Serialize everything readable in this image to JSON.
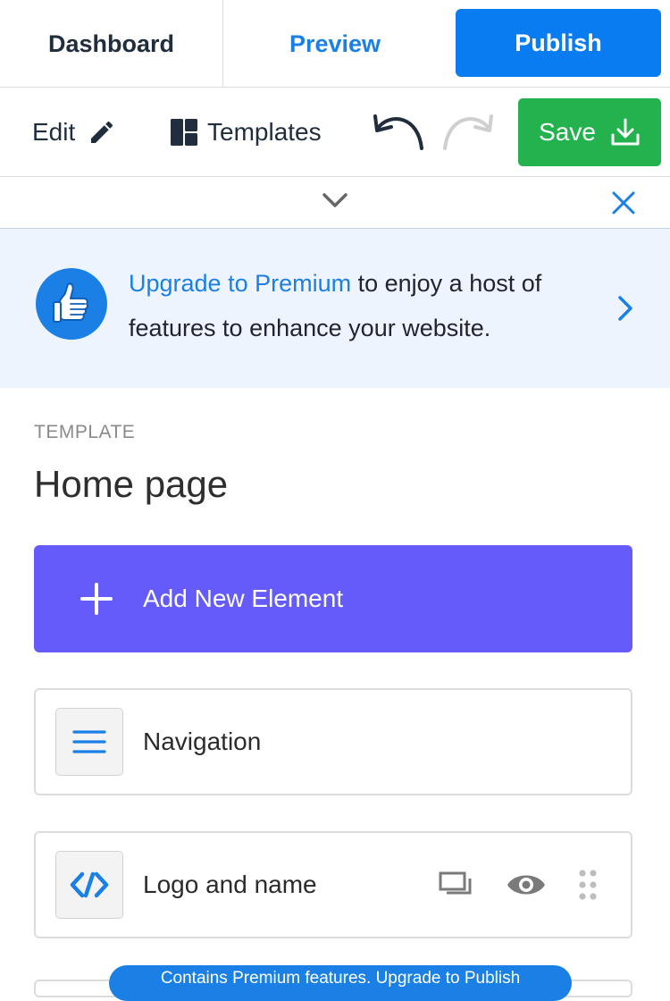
{
  "topbar": {
    "dashboard_label": "Dashboard",
    "preview_label": "Preview",
    "publish_label": "Publish"
  },
  "toolbar": {
    "edit_label": "Edit",
    "templates_label": "Templates",
    "save_label": "Save"
  },
  "banner": {
    "link_text": "Upgrade to Premium",
    "text": " to enjoy a host of features to enhance your website."
  },
  "template": {
    "section_label": "TEMPLATE",
    "title": "Home page",
    "add_label": "Add New Element"
  },
  "elements": [
    {
      "label": "Navigation",
      "icon": "hamburger-menu-icon"
    },
    {
      "label": "Logo and name",
      "icon": "code-logo-icon"
    }
  ],
  "premium_notice": "Contains Premium features. Upgrade to Publish",
  "colors": {
    "primary_blue": "#0a7cf2",
    "save_green": "#23b24d",
    "add_purple": "#645bfa",
    "banner_bg": "#edf4fd",
    "icons": [
      "pencil-icon",
      "templates-grid-icon",
      "undo-icon",
      "redo-icon",
      "download-icon",
      "chevron-down-icon",
      "close-icon",
      "thumbs-up-icon",
      "chevron-right-icon",
      "plus-icon",
      "duplicate-icon",
      "eye-icon",
      "drag-handle-icon"
    ]
  }
}
